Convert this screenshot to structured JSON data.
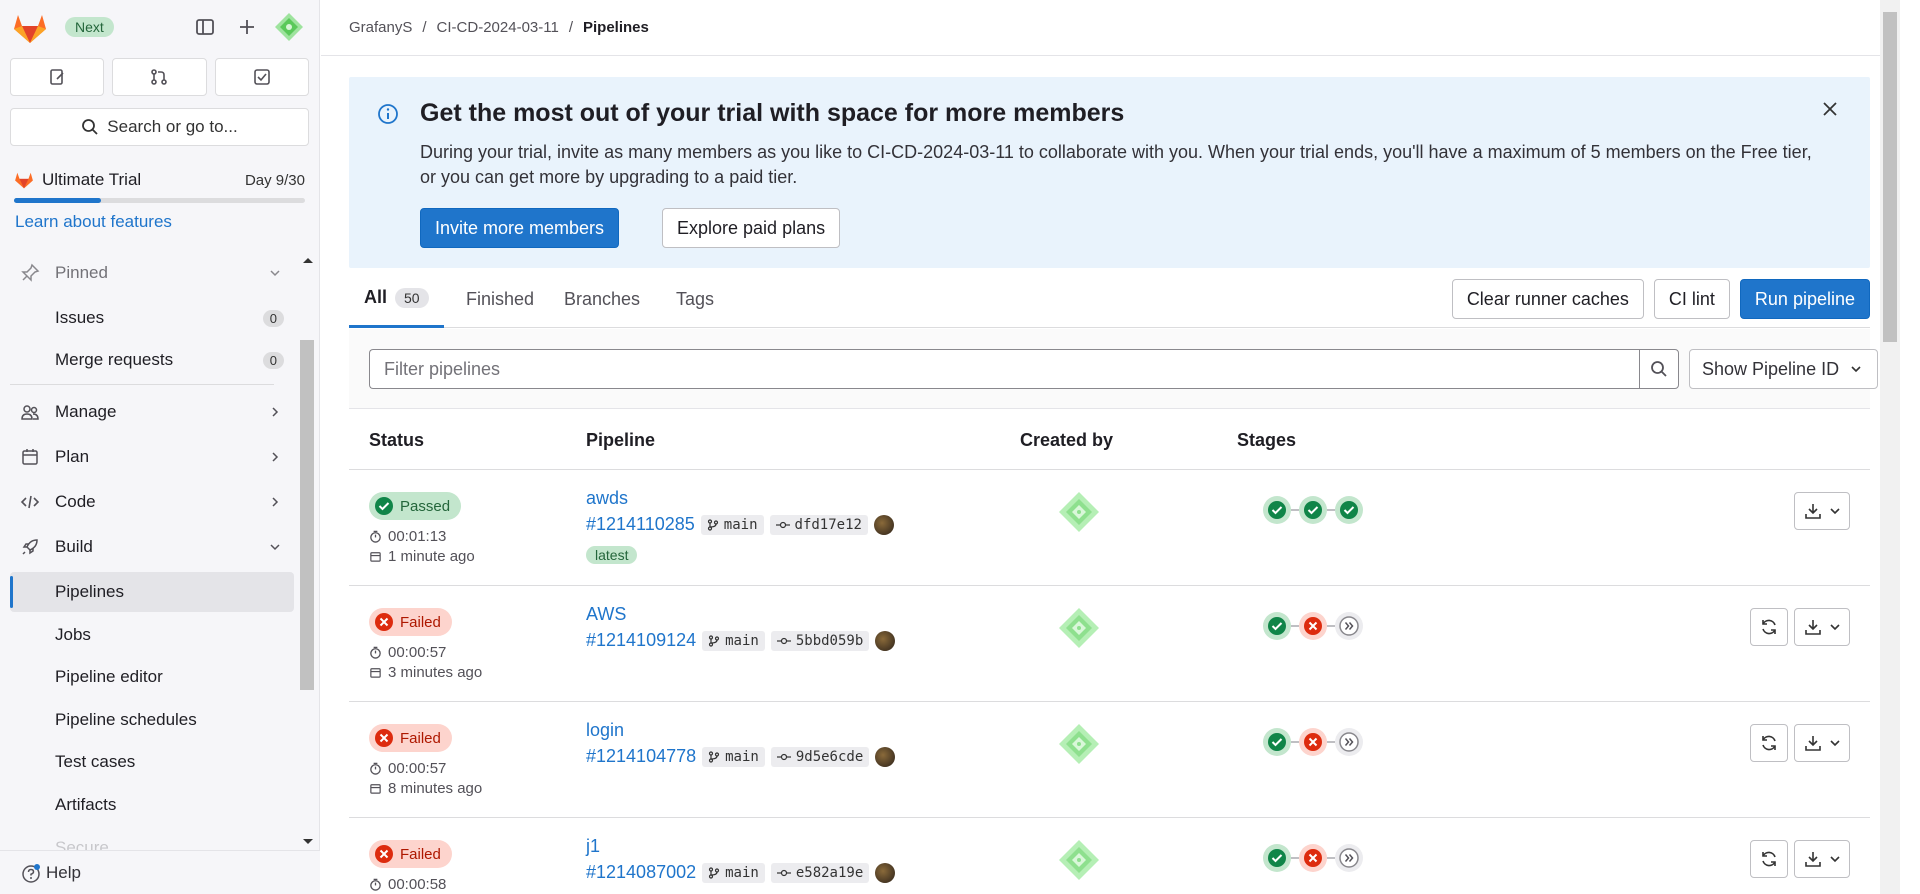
{
  "sidebar": {
    "next_badge": "Next",
    "search_label": "Search or go to...",
    "trial": {
      "name": "Ultimate Trial",
      "day": "Day 9/30",
      "progress": 0.3
    },
    "learn_link": "Learn about features",
    "nav": {
      "pinned": "Pinned",
      "issues": "Issues",
      "issues_count": "0",
      "merge_requests": "Merge requests",
      "merge_requests_count": "0",
      "manage": "Manage",
      "plan": "Plan",
      "code": "Code",
      "build": "Build",
      "pipelines": "Pipelines",
      "jobs": "Jobs",
      "pipeline_editor": "Pipeline editor",
      "pipeline_schedules": "Pipeline schedules",
      "test_cases": "Test cases",
      "artifacts": "Artifacts",
      "secure": "Secure"
    },
    "help": "Help"
  },
  "breadcrumb": {
    "group": "GrafanyS",
    "project": "CI-CD-2024-03-11",
    "page": "Pipelines",
    "sep": "/"
  },
  "banner": {
    "title": "Get the most out of your trial with space for more members",
    "body": "During your trial, invite as many members as you like to CI-CD-2024-03-11 to collaborate with you. When your trial ends, you'll have a maximum of 5 members on the Free tier, or you can get more by upgrading to a paid tier.",
    "invite_button": "Invite more members",
    "explore_button": "Explore paid plans"
  },
  "tabs": {
    "all": "All",
    "all_count": "50",
    "finished": "Finished",
    "branches": "Branches",
    "tags": "Tags"
  },
  "actions": {
    "clear_caches": "Clear runner caches",
    "ci_lint": "CI lint",
    "run_pipeline": "Run pipeline"
  },
  "filter": {
    "placeholder": "Filter pipelines",
    "show_id": "Show Pipeline ID"
  },
  "table": {
    "headers": {
      "status": "Status",
      "pipeline": "Pipeline",
      "created_by": "Created by",
      "stages": "Stages"
    },
    "rows": [
      {
        "status": "Passed",
        "duration": "00:01:13",
        "ago": "1 minute ago",
        "name": "awds",
        "id": "#1214110285",
        "branch": "main",
        "sha": "dfd17e12",
        "tag": "latest",
        "stages": [
          "success",
          "success",
          "success"
        ]
      },
      {
        "status": "Failed",
        "duration": "00:00:57",
        "ago": "3 minutes ago",
        "name": "AWS",
        "id": "#1214109124",
        "branch": "main",
        "sha": "5bbd059b",
        "stages": [
          "success",
          "failed",
          "skipped"
        ]
      },
      {
        "status": "Failed",
        "duration": "00:00:57",
        "ago": "8 minutes ago",
        "name": "login",
        "id": "#1214104778",
        "branch": "main",
        "sha": "9d5e6cde",
        "stages": [
          "success",
          "failed",
          "skipped"
        ]
      },
      {
        "status": "Failed",
        "duration": "00:00:58",
        "ago": "",
        "name": "j1",
        "id": "#1214087002",
        "branch": "main",
        "sha": "e582a19e",
        "stages": [
          "success",
          "failed",
          "skipped"
        ]
      }
    ]
  },
  "colors": {
    "accent": "#1f75cb",
    "success": "#108548",
    "danger": "#dd2b0e",
    "banner_bg": "#e9f3fc"
  }
}
